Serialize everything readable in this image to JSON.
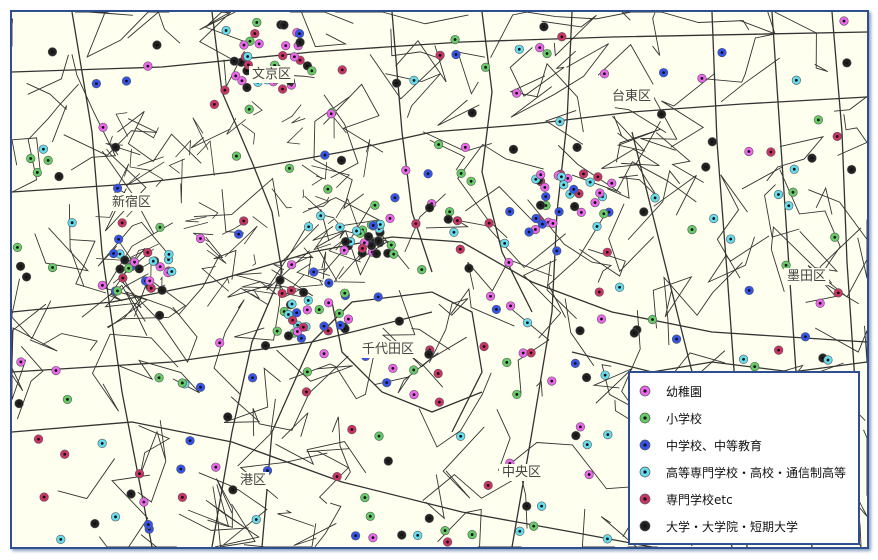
{
  "wards": [
    {
      "label": "文京区"
    },
    {
      "label": "台東区"
    },
    {
      "label": "新宿区"
    },
    {
      "label": "墨田区"
    },
    {
      "label": "千代田区"
    },
    {
      "label": "中央区"
    },
    {
      "label": "港区"
    }
  ],
  "legend": {
    "items": [
      {
        "label": "幼稚園",
        "color": "#ee66ee"
      },
      {
        "label": "小学校",
        "color": "#66cc66"
      },
      {
        "label": "中学校、中等教育",
        "color": "#3355ee"
      },
      {
        "label": "高等専門学校・高校・通信制高等",
        "color": "#66ddee"
      },
      {
        "label": "専門学校etc",
        "color": "#cc3366"
      },
      {
        "label": "大学・大学院・短期大学",
        "color": "#222222"
      }
    ]
  },
  "colors": {
    "background": "#fffff0",
    "roads": "#333333",
    "frame": "#2d4f8f"
  }
}
